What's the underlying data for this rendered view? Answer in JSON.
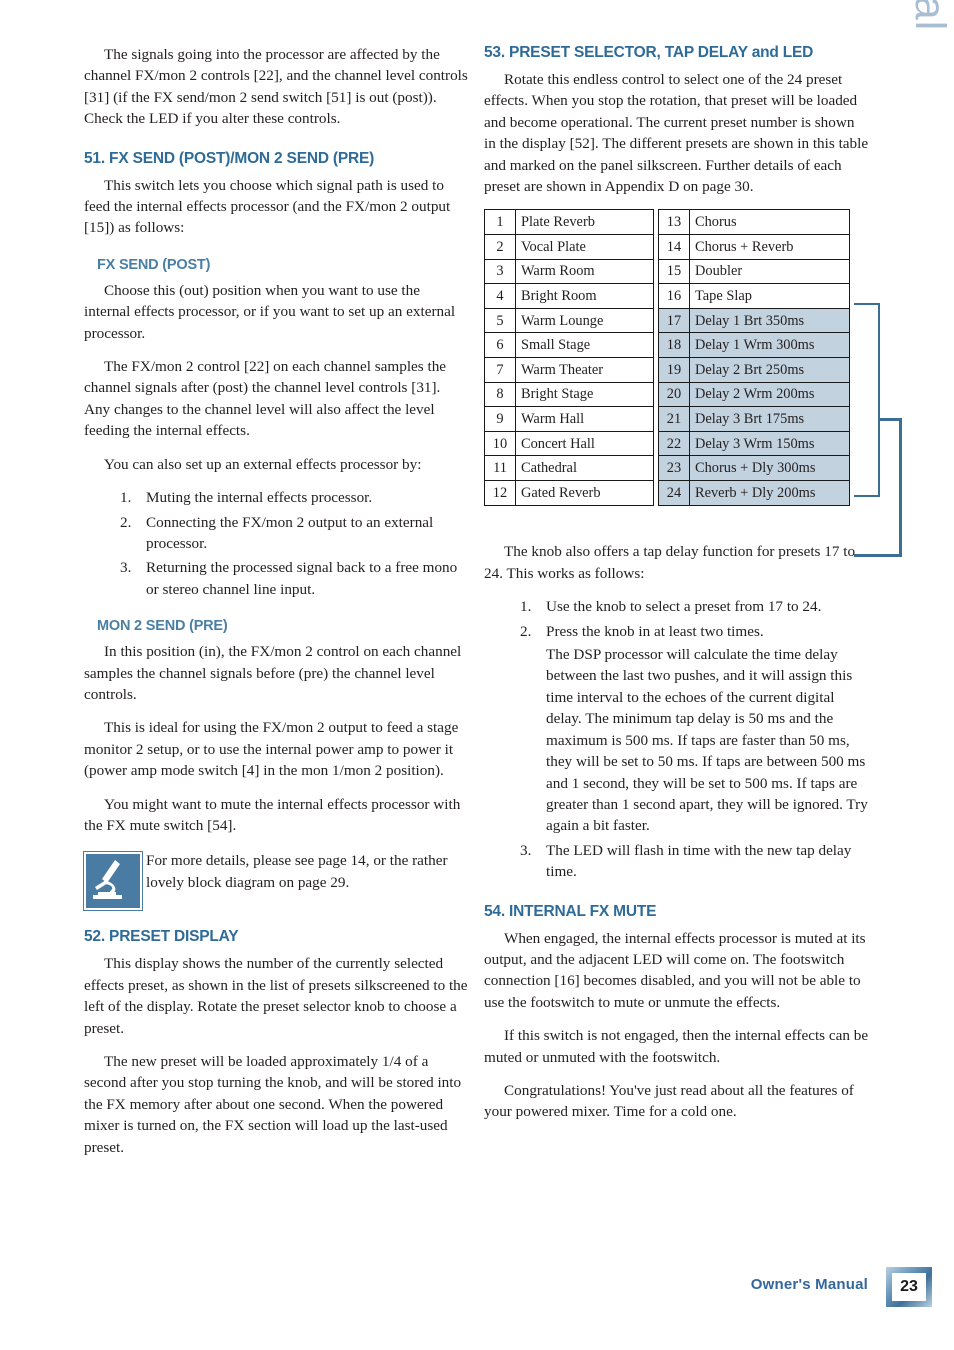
{
  "side_title": "Owner's Manual",
  "left_column": {
    "intro_paragraph": "The signals going into the processor are affected by the channel FX/mon 2 controls [22], and the channel level controls [31] (if the FX send/mon 2 send switch [51] is out (post)). Check the LED if you alter these controls.",
    "section_51": {
      "heading": "51. FX SEND (POST)/MON 2 SEND (PRE)",
      "paragraph": "This switch lets you choose which signal path is used to feed the internal effects processor (and the FX/mon 2 output [15]) as follows:",
      "sub_fx_send": {
        "heading": "FX SEND (POST)",
        "p1": "Choose this (out) position when you want to use the internal effects processor, or if you want to set up an external processor.",
        "p2": "The FX/mon 2 control [22] on each channel samples the channel signals after (post) the channel level controls [31]. Any changes to the channel level will also affect the level feeding the internal effects.",
        "p3": "You can also set up an external effects processor by:",
        "steps": [
          "Muting the internal effects processor.",
          "Connecting the FX/mon 2 output to an external processor.",
          "Returning the processed signal back to a free mono or stereo channel line input."
        ]
      },
      "sub_mon2_send": {
        "heading": "MON 2 SEND (PRE)",
        "p1": "In this position (in), the FX/mon 2 control on each channel samples the channel signals before (pre) the channel level controls.",
        "p2": "This is ideal for using the FX/mon 2 output to feed a stage monitor 2 setup, or to use the internal power amp to power it (power amp mode switch [4] in the mon 1/mon 2 position).",
        "p3": "You might want to mute the internal effects processor with the FX mute switch [54]."
      },
      "closer_look": {
        "badge_text": "A CLOSER LOOK",
        "text": "For more details, please see page 14, or the rather lovely block diagram on page 29."
      }
    },
    "section_52": {
      "heading": "52. PRESET DISPLAY",
      "p1": "This display shows the number of the currently selected effects preset, as shown in the list of presets silkscreened to the left of the display. Rotate the preset selector knob to choose a preset.",
      "p2": "The new preset will be loaded approximately 1/4 of a second after you stop turning the knob, and will be stored into the FX memory after about one second. When the powered mixer is turned on, the FX section will load up the last-used preset."
    }
  },
  "right_column": {
    "section_53": {
      "heading": "53. PRESET SELECTOR, TAP DELAY and LED",
      "p1": "Rotate this endless control to select one of the 24 preset effects. When you stop the rotation, that preset will be loaded and become operational. The current preset number is shown in the display [52]. The different presets are shown in this table and marked on the panel silkscreen. Further details of each preset are shown in Appendix D on page 30.",
      "preset_table_left": [
        {
          "num": "1",
          "name": "Plate Reverb",
          "shaded": false
        },
        {
          "num": "2",
          "name": "Vocal Plate",
          "shaded": false
        },
        {
          "num": "3",
          "name": "Warm Room",
          "shaded": false
        },
        {
          "num": "4",
          "name": "Bright Room",
          "shaded": false
        },
        {
          "num": "5",
          "name": "Warm Lounge",
          "shaded": false
        },
        {
          "num": "6",
          "name": "Small Stage",
          "shaded": false
        },
        {
          "num": "7",
          "name": "Warm Theater",
          "shaded": false
        },
        {
          "num": "8",
          "name": "Bright Stage",
          "shaded": false
        },
        {
          "num": "9",
          "name": "Warm Hall",
          "shaded": false
        },
        {
          "num": "10",
          "name": "Concert Hall",
          "shaded": false
        },
        {
          "num": "11",
          "name": "Cathedral",
          "shaded": false
        },
        {
          "num": "12",
          "name": "Gated Reverb",
          "shaded": false
        }
      ],
      "preset_table_right": [
        {
          "num": "13",
          "name": "Chorus",
          "shaded": false
        },
        {
          "num": "14",
          "name": "Chorus + Reverb",
          "shaded": false
        },
        {
          "num": "15",
          "name": "Doubler",
          "shaded": false
        },
        {
          "num": "16",
          "name": "Tape Slap",
          "shaded": false
        },
        {
          "num": "17",
          "name": "Delay 1 Brt 350ms",
          "shaded": true
        },
        {
          "num": "18",
          "name": "Delay 1 Wrm 300ms",
          "shaded": true
        },
        {
          "num": "19",
          "name": "Delay 2 Brt 250ms",
          "shaded": true
        },
        {
          "num": "20",
          "name": "Delay 2 Wrm 200ms",
          "shaded": true
        },
        {
          "num": "21",
          "name": "Delay 3 Brt 175ms",
          "shaded": true
        },
        {
          "num": "22",
          "name": "Delay 3 Wrm 150ms",
          "shaded": true
        },
        {
          "num": "23",
          "name": "Chorus + Dly 300ms",
          "shaded": true
        },
        {
          "num": "24",
          "name": "Reverb + Dly 200ms",
          "shaded": true
        }
      ],
      "tap_paragraph": "The knob also offers a tap delay function for presets 17 to 24. This works as follows:",
      "tap_steps": [
        {
          "text": "Use the knob to select a preset from 17 to 24.",
          "cont": ""
        },
        {
          "text": "Press the knob in at least two times.",
          "cont": "The DSP processor will calculate the time delay between the last two pushes, and it will assign this time interval to the echoes of the current digital delay. The minimum tap delay is 50 ms and the maximum is 500 ms. If taps are faster than 50 ms, they will be set to 50 ms. If taps are between 500 ms and 1 second, they will be set to 500 ms. If taps are greater than 1 second apart, they will be ignored. Try again a bit faster."
        },
        {
          "text": "The LED will flash in time with the new tap delay time.",
          "cont": ""
        }
      ]
    },
    "section_54": {
      "heading": "54. INTERNAL FX MUTE",
      "p1": "When engaged, the internal effects processor is muted at its output, and the adjacent LED will come on. The footswitch connection [16] becomes disabled, and you will not be able to use the footswitch to mute or unmute the effects.",
      "p2": "If this switch is not engaged, then the internal effects can be muted or unmuted with the footswitch.",
      "p3": "Congratulations! You've just read about all the features of your powered mixer. Time for a cold one."
    }
  },
  "footer": {
    "label": "Owner's Manual",
    "page_number": "23"
  },
  "colors": {
    "heading_blue": "#2e6b98",
    "subheading_blue": "#4a7fa5",
    "side_title_blue": "#a8bed2",
    "table_shade": "#c2d2df",
    "bracket_blue": "#3c6e91",
    "footer_blue": "#35689a"
  }
}
